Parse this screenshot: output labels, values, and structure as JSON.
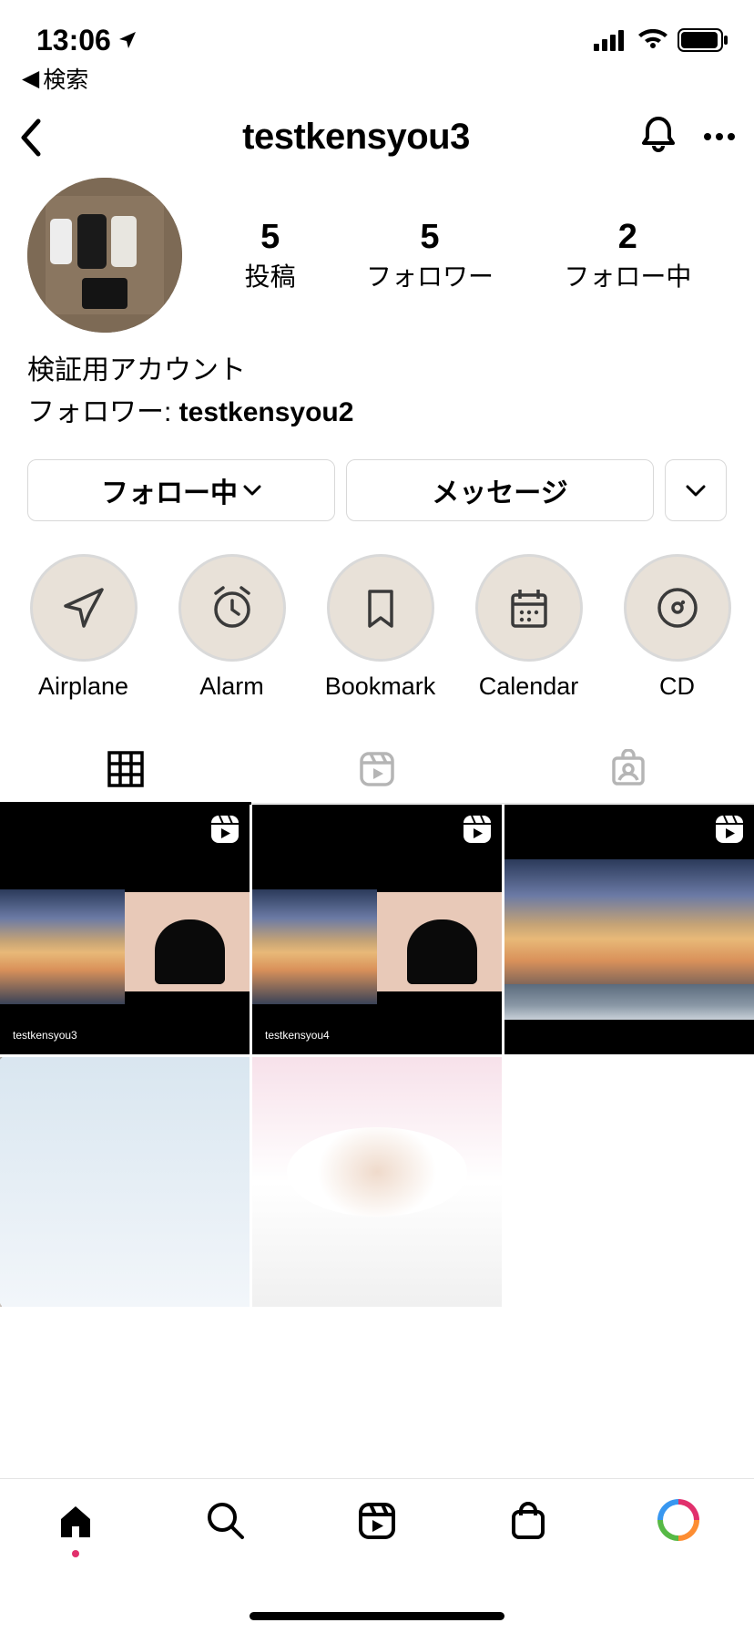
{
  "status_bar": {
    "time": "13:06",
    "back_app": "検索"
  },
  "header": {
    "username": "testkensyou3"
  },
  "stats": {
    "posts": {
      "count": "5",
      "label": "投稿"
    },
    "followers": {
      "count": "5",
      "label": "フォロワー"
    },
    "following": {
      "count": "2",
      "label": "フォロー中"
    }
  },
  "bio": {
    "display_name": "検証用アカウント",
    "followed_by_prefix": "フォロワー: ",
    "followed_by_name": "testkensyou2"
  },
  "buttons": {
    "following": "フォロー中",
    "message": "メッセージ"
  },
  "highlights": [
    {
      "label": "Airplane",
      "icon": "airplane-icon"
    },
    {
      "label": "Alarm",
      "icon": "alarm-icon"
    },
    {
      "label": "Bookmark",
      "icon": "bookmark-icon"
    },
    {
      "label": "Calendar",
      "icon": "calendar-icon"
    },
    {
      "label": "CD",
      "icon": "cd-icon"
    }
  ],
  "posts": [
    {
      "type": "reel",
      "caption": "testkensyou3"
    },
    {
      "type": "reel",
      "caption": "testkensyou4"
    },
    {
      "type": "reel",
      "caption": ""
    },
    {
      "type": "photo"
    },
    {
      "type": "photo"
    }
  ]
}
